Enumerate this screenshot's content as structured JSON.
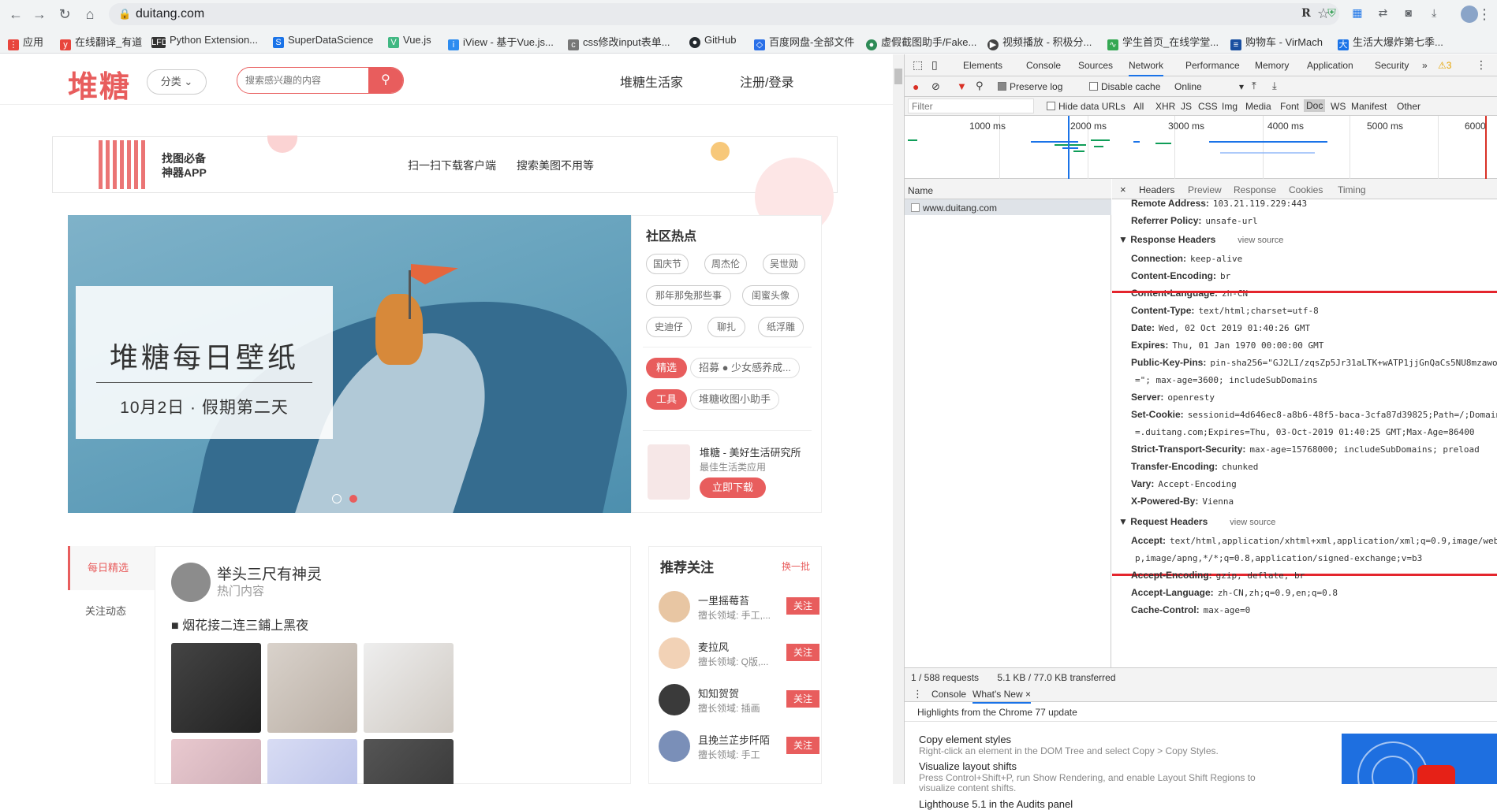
{
  "browser": {
    "url": "duitang.com",
    "bookmarks": [
      {
        "label": "应用",
        "icon": "apps-grid-icon",
        "color": "#e8453c"
      },
      {
        "label": "在线翻译_有道",
        "icon": "youdao-icon",
        "color": "#e8453c"
      },
      {
        "label": "Python Extension...",
        "icon": "lfd-icon",
        "color": "#333333"
      },
      {
        "label": "SuperDataScience",
        "icon": "sds-icon",
        "color": "#1a73e8"
      },
      {
        "label": "Vue.js",
        "icon": "vue-icon",
        "color": "#41b883"
      },
      {
        "label": "iView - 基于Vue.js...",
        "icon": "iview-icon",
        "color": "#2d8cf0"
      },
      {
        "label": "css修改input表单...",
        "icon": "css-icon",
        "color": "#555555"
      },
      {
        "label": "GitHub",
        "icon": "github-icon",
        "color": "#24292e"
      },
      {
        "label": "百度网盘-全部文件",
        "icon": "baidu-pan-icon",
        "color": "#2a70e8"
      },
      {
        "label": "虚假截图助手/Fake...",
        "icon": "fake-icon",
        "color": "#2e8b57"
      },
      {
        "label": "视频播放 - 积极分...",
        "icon": "video-icon",
        "color": "#444444"
      },
      {
        "label": "学生首页_在线学堂...",
        "icon": "school-icon",
        "color": "#34a853"
      },
      {
        "label": "购物车 - VirMach",
        "icon": "cart-icon",
        "color": "#1a4fa0"
      },
      {
        "label": "生活大爆炸第七季...",
        "icon": "tv-icon",
        "color": "#1a73e8"
      }
    ]
  },
  "site": {
    "logo": "堆糖",
    "category_btn": "分类",
    "search_placeholder": "搜索感兴趣的内容",
    "nav_life": "堆糖生活家",
    "nav_login": "注册/登录",
    "banner_app": "找图必备\n神器APP",
    "banner_scan": "扫一扫下载客户端",
    "banner_search": "搜索美图不用等",
    "hero_title": "堆糖每日壁纸",
    "hero_subtitle": "10月2日 · 假期第二天",
    "hot_title": "社区热点",
    "hot_tags": [
      "国庆节",
      "周杰伦",
      "吴世勋",
      "那年那兔那些事",
      "闺蜜头像",
      "史迪仔",
      "聊扎",
      "纸浮雕"
    ],
    "featured_label": "精选",
    "featured_text": "招募 ● 少女感养成...",
    "tool_label": "工具",
    "tool_text": "堆糖收图小助手",
    "app_title": "堆糖 - 美好生活研究所",
    "app_sub": "最佳生活类应用",
    "app_download": "立即下载",
    "side_daily": "每日精选",
    "side_follow": "关注动态",
    "feed_user": "举头三尺有神灵",
    "feed_user_sub": "热门内容",
    "feed_title": "■ 烟花接二连三鋪上黑夜",
    "rec_title": "推荐关注",
    "rec_change": "换一批",
    "rec_users": [
      {
        "name": "一里摇莓苔",
        "desc": "擅长领域: 手工,...",
        "follow": "关注"
      },
      {
        "name": "麦拉风",
        "desc": "擅长领域: Q版,...",
        "follow": "关注"
      },
      {
        "name": "知知贺贺",
        "desc": "擅长领域: 插画",
        "follow": "关注"
      },
      {
        "name": "且挽兰芷步阡陌",
        "desc": "擅长领域: 手工",
        "follow": "关注"
      }
    ]
  },
  "devtools": {
    "tabs": [
      "Elements",
      "Console",
      "Sources",
      "Network",
      "Performance",
      "Memory",
      "Application",
      "Security"
    ],
    "more": "»",
    "warn_count": "3",
    "preserve_log": "Preserve log",
    "disable_cache": "Disable cache",
    "throttle": "Online",
    "filter_placeholder": "Filter",
    "hide_data_urls": "Hide data URLs",
    "filter_types": [
      "All",
      "XHR",
      "JS",
      "CSS",
      "Img",
      "Media",
      "Font",
      "Doc",
      "WS",
      "Manifest",
      "Other"
    ],
    "timeline_ticks": [
      "1000 ms",
      "2000 ms",
      "3000 ms",
      "4000 ms",
      "5000 ms",
      "6000"
    ],
    "name_header": "Name",
    "request_name": "www.duitang.com",
    "detail_tabs": [
      "Headers",
      "Preview",
      "Response",
      "Cookies",
      "Timing"
    ],
    "general": [
      {
        "k": "Remote Address:",
        "v": "103.21.119.229:443"
      },
      {
        "k": "Referrer Policy:",
        "v": "unsafe-url"
      }
    ],
    "response_headers_title": "▼ Response Headers",
    "view_source": "view source",
    "response_headers": [
      {
        "k": "Connection:",
        "v": "keep-alive"
      },
      {
        "k": "Content-Encoding:",
        "v": "br"
      },
      {
        "k": "Content-Language:",
        "v": "zh-CN"
      },
      {
        "k": "Content-Type:",
        "v": "text/html;charset=utf-8"
      },
      {
        "k": "Date:",
        "v": "Wed, 02 Oct 2019 01:40:26 GMT"
      },
      {
        "k": "Expires:",
        "v": "Thu, 01 Jan 1970 00:00:00 GMT"
      },
      {
        "k": "Public-Key-Pins:",
        "v": "pin-sha256=\"GJ2LI/zqsZp5Jr31aLTK+wATP1jjGnQaCs5NU8mzawo"
      },
      {
        "k": "",
        "v": "=\"; max-age=3600; includeSubDomains"
      },
      {
        "k": "Server:",
        "v": "openresty"
      },
      {
        "k": "Set-Cookie:",
        "v": "sessionid=4d646ec8-a8b6-48f5-baca-3cfa87d39825;Path=/;Domain"
      },
      {
        "k": "",
        "v": "=.duitang.com;Expires=Thu, 03-Oct-2019 01:40:25 GMT;Max-Age=86400"
      },
      {
        "k": "Strict-Transport-Security:",
        "v": "max-age=15768000; includeSubDomains; preload"
      },
      {
        "k": "Transfer-Encoding:",
        "v": "chunked"
      },
      {
        "k": "Vary:",
        "v": "Accept-Encoding"
      },
      {
        "k": "X-Powered-By:",
        "v": "Vienna"
      }
    ],
    "request_headers_title": "▼ Request Headers",
    "request_headers": [
      {
        "k": "Accept:",
        "v": "text/html,application/xhtml+xml,application/xml;q=0.9,image/web"
      },
      {
        "k": "",
        "v": "p,image/apng,*/*;q=0.8,application/signed-exchange;v=b3"
      },
      {
        "k": "Accept-Encoding:",
        "v": "gzip, deflate, br"
      },
      {
        "k": "Accept-Language:",
        "v": "zh-CN,zh;q=0.9,en;q=0.8"
      },
      {
        "k": "Cache-Control:",
        "v": "max-age=0"
      }
    ],
    "status_requests": "1 / 588 requests",
    "status_transferred": "5.1 KB / 77.0 KB transferred",
    "drawer_console": "Console",
    "drawer_whatsnew": "What's New",
    "whatsnew_highlight": "Highlights from the Chrome 77 update",
    "whatsnew_items": [
      {
        "title": "Copy element styles",
        "desc": "Right-click an element in the DOM Tree and select Copy > Copy Styles."
      },
      {
        "title": "Visualize layout shifts",
        "desc": "Press Control+Shift+P, run Show Rendering, and enable Layout Shift Regions to visualize content shifts."
      },
      {
        "title": "Lighthouse 5.1 in the Audits panel",
        "desc": ""
      }
    ]
  }
}
